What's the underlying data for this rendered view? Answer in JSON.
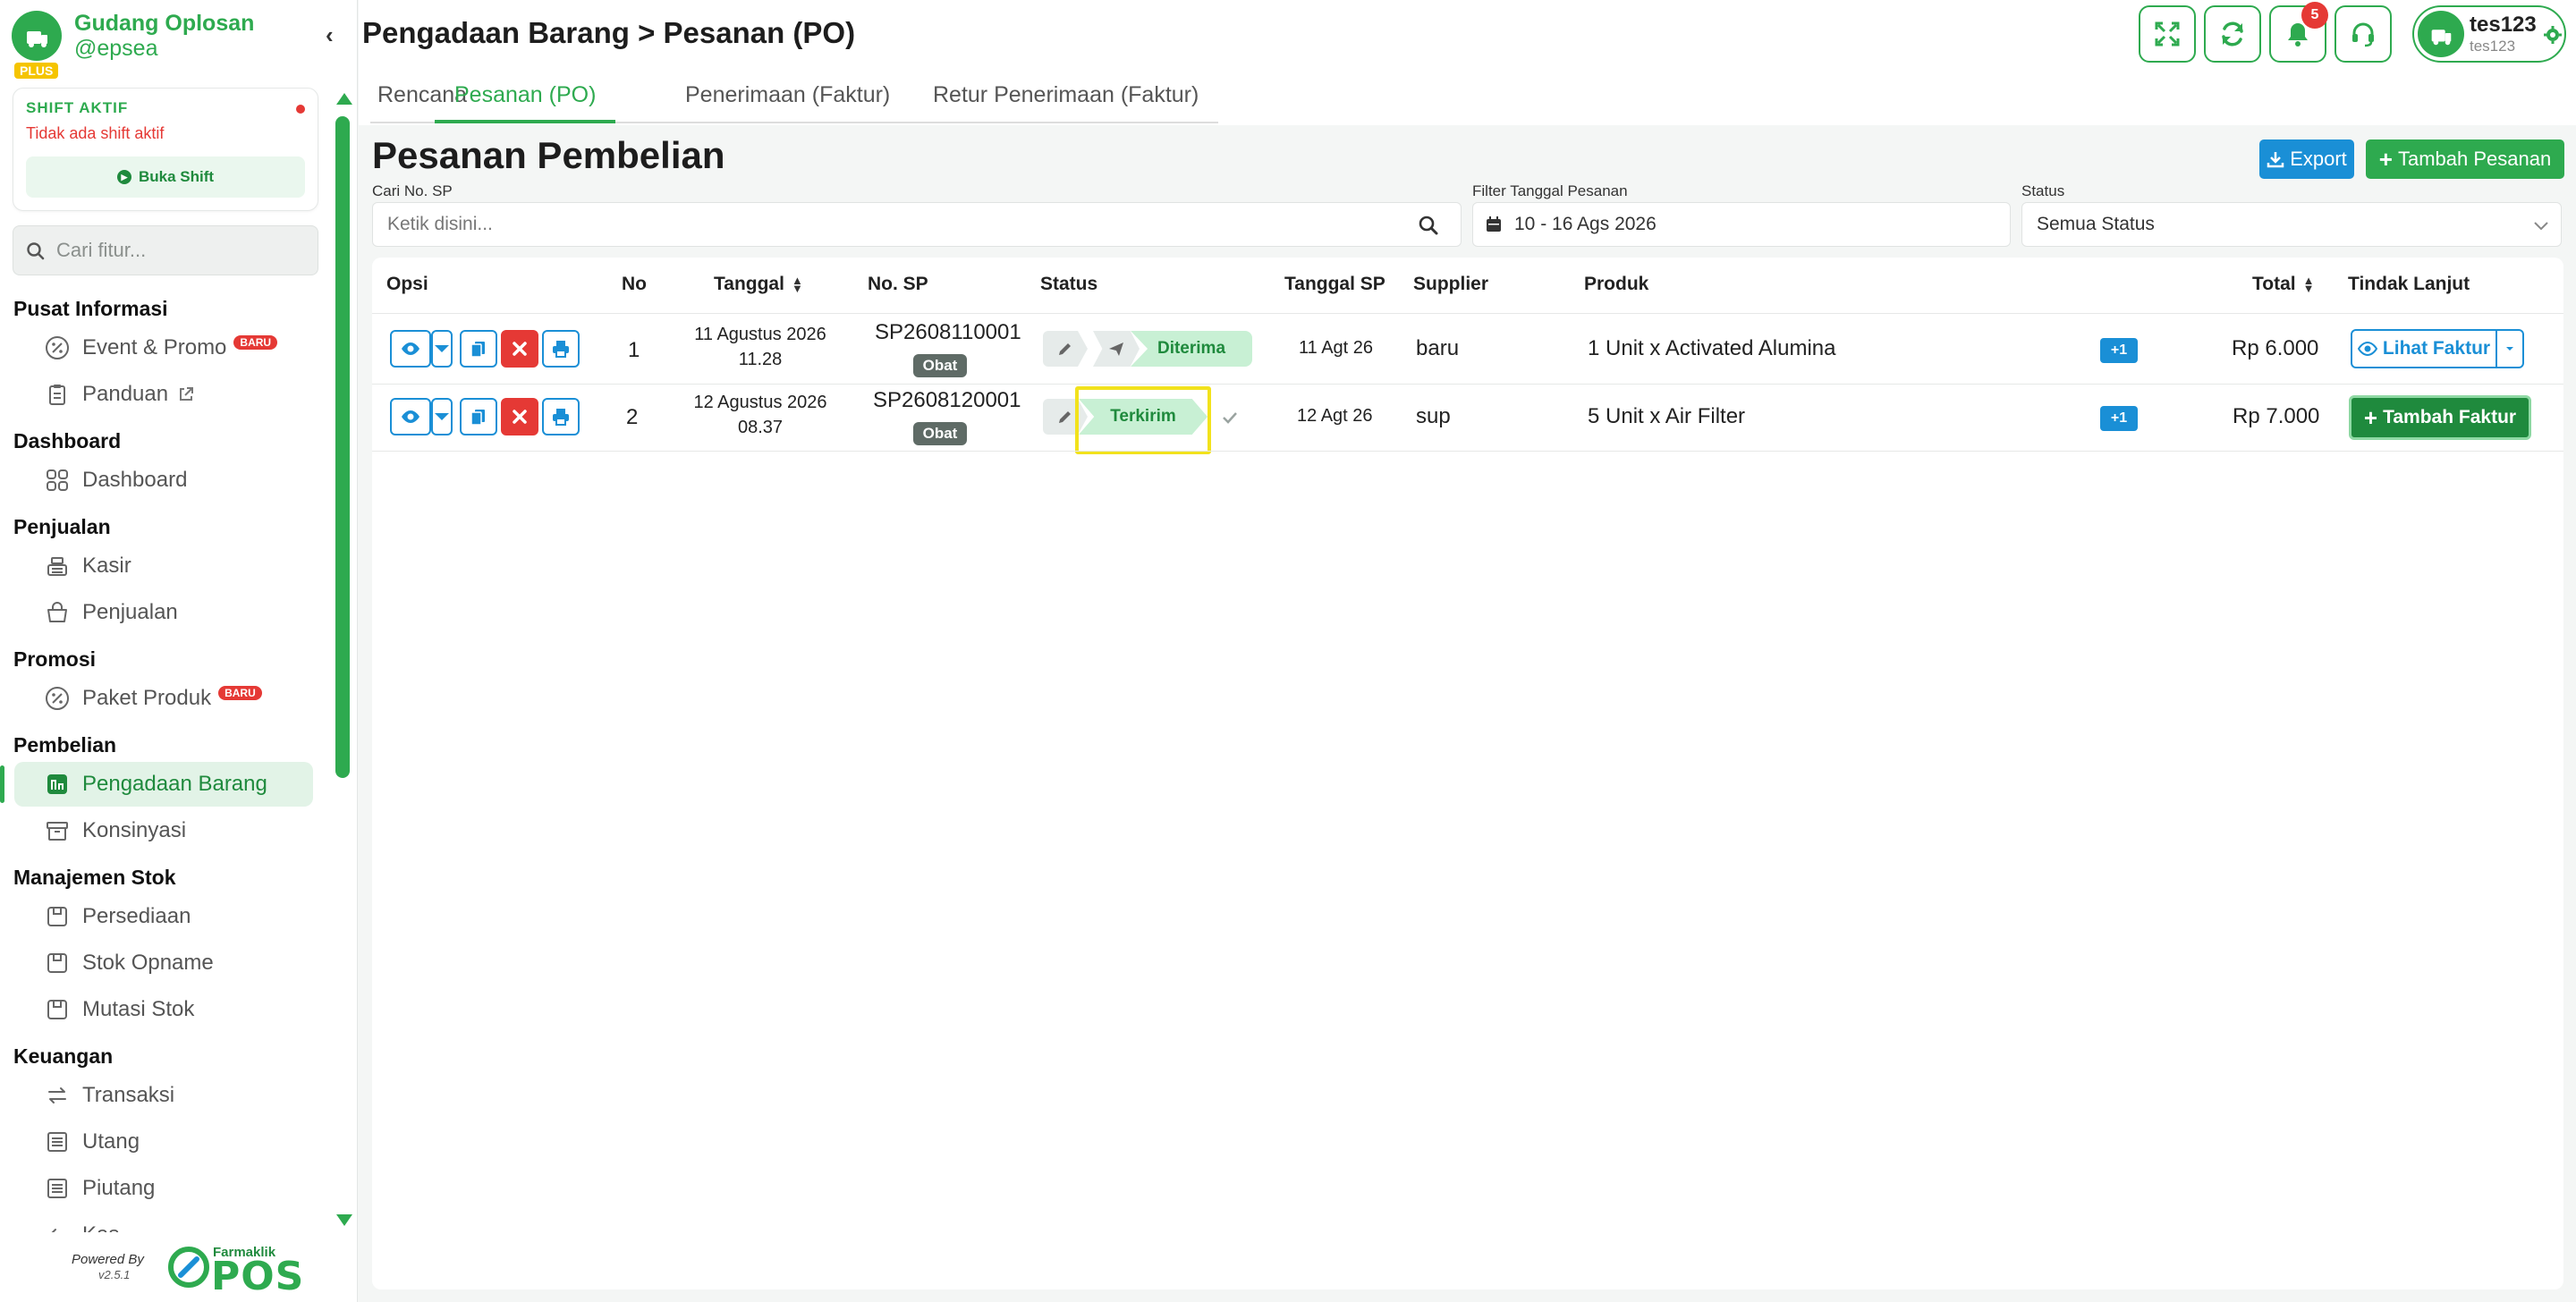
{
  "brand": {
    "name": "Gudang Oplosan",
    "handle": "@epsea",
    "plan_badge": "PLUS"
  },
  "shift": {
    "title": "SHIFT AKTIF",
    "status": "Tidak ada shift aktif",
    "button_label": "Buka Shift"
  },
  "sidebar_search": {
    "placeholder": "Cari fitur..."
  },
  "sidebar": {
    "sections": [
      {
        "title": "Pusat Informasi",
        "items": [
          {
            "label": "Event & Promo",
            "badge": "BARU",
            "icon": "percent-icon"
          },
          {
            "label": "Panduan",
            "icon": "clipboard-icon"
          }
        ]
      },
      {
        "title": "Dashboard",
        "items": [
          {
            "label": "Dashboard",
            "icon": "grid-icon"
          }
        ]
      },
      {
        "title": "Penjualan",
        "items": [
          {
            "label": "Kasir",
            "icon": "cash-register-icon"
          },
          {
            "label": "Penjualan",
            "icon": "basket-icon"
          }
        ]
      },
      {
        "title": "Promosi",
        "items": [
          {
            "label": "Paket Produk",
            "badge": "BARU",
            "icon": "percent-icon"
          }
        ]
      },
      {
        "title": "Pembelian",
        "items": [
          {
            "label": "Pengadaan Barang",
            "icon": "procurement-icon",
            "active": true
          },
          {
            "label": "Konsinyasi",
            "icon": "archive-icon"
          }
        ]
      },
      {
        "title": "Manajemen Stok",
        "items": [
          {
            "label": "Persediaan",
            "icon": "box-icon"
          },
          {
            "label": "Stok Opname",
            "icon": "box-icon"
          },
          {
            "label": "Mutasi Stok",
            "icon": "box-icon"
          }
        ]
      },
      {
        "title": "Keuangan",
        "items": [
          {
            "label": "Transaksi",
            "icon": "exchange-icon"
          },
          {
            "label": "Utang",
            "icon": "ledger-icon"
          },
          {
            "label": "Piutang",
            "icon": "ledger-icon"
          },
          {
            "label": "Kas",
            "icon": "arrow-left-icon"
          }
        ]
      }
    ]
  },
  "footer": {
    "powered_by": "Powered By",
    "version": "v2.5.1",
    "product_name": "Farmaklik",
    "product_pos": "POS"
  },
  "header": {
    "breadcrumb": "Pengadaan Barang > Pesanan (PO)",
    "notification_count": "5",
    "user": {
      "name": "tes123",
      "sub": "tes123"
    }
  },
  "tabs": [
    {
      "label": "Rencana",
      "active": false
    },
    {
      "label": "Pesanan (PO)",
      "active": true
    },
    {
      "label": "Penerimaan (Faktur)",
      "active": false
    },
    {
      "label": "Retur Penerimaan (Faktur)",
      "active": false
    }
  ],
  "main": {
    "title": "Pesanan Pembelian",
    "export_label": "Export",
    "add_label": "Tambah Pesanan"
  },
  "filters": {
    "search_label": "Cari No. SP",
    "search_placeholder": "Ketik disini...",
    "date_label": "Filter Tanggal Pesanan",
    "date_value": "10 - 16 Ags 2026",
    "status_label": "Status",
    "status_value": "Semua Status"
  },
  "table": {
    "columns": [
      "Opsi",
      "No",
      "Tanggal",
      "No. SP",
      "Status",
      "Tanggal SP",
      "Supplier",
      "Produk",
      "Total",
      "Tindak Lanjut"
    ],
    "rows": [
      {
        "no": "1",
        "date": "11 Agustus 2026",
        "time": "11.28",
        "sp": "SP2608110001",
        "tag": "Obat",
        "status": "Diterima",
        "sp_date": "11 Agt 26",
        "supplier": "baru",
        "product": "1 Unit x Activated Alumina",
        "more": "+1",
        "total": "Rp 6.000",
        "action": "Lihat Faktur"
      },
      {
        "no": "2",
        "date": "12 Agustus 2026",
        "time": "08.37",
        "sp": "SP2608120001",
        "tag": "Obat",
        "status": "Terkirim",
        "sp_date": "12 Agt 26",
        "supplier": "sup",
        "product": "5 Unit x Air Filter",
        "more": "+1",
        "total": "Rp 7.000",
        "action": "Tambah Faktur"
      }
    ]
  },
  "colors": {
    "primary": "#2eaa4f",
    "blue": "#1a8fd6",
    "danger": "#e53935",
    "highlight": "#f2e21c"
  }
}
